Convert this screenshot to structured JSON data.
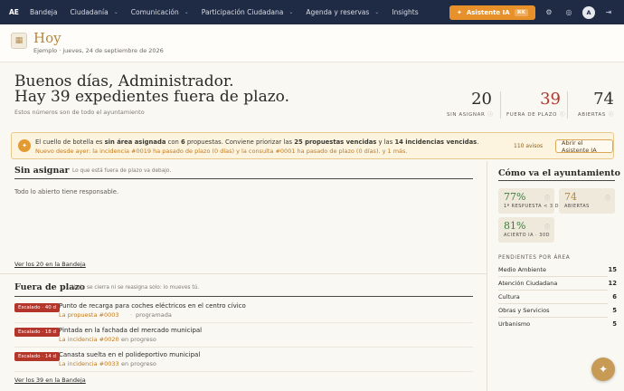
{
  "nav": {
    "logo": "AE",
    "items": [
      {
        "label": "Bandeja",
        "chevron": false
      },
      {
        "label": "Ciudadanía",
        "chevron": true
      },
      {
        "label": "Comunicación",
        "chevron": true
      },
      {
        "label": "Participación Ciudadana",
        "chevron": true
      },
      {
        "label": "Agenda y reservas",
        "chevron": true
      },
      {
        "label": "Insights",
        "chevron": false
      }
    ],
    "ia_button": "Asistente IA",
    "ia_shortcut": "⌘K",
    "avatar": "A"
  },
  "header": {
    "title": "Hoy",
    "subtitle": "Ejemplo · jueves, 24 de septiembre de 2026"
  },
  "greeting": {
    "line1": "Buenos días, Administrador.",
    "line2": "Hay 39 expedientes fuera de plazo.",
    "note": "Estos números son de todo el ayuntamiento"
  },
  "stats": [
    {
      "value": "20",
      "label": "SIN ASIGNAR",
      "color": "#2b2a27"
    },
    {
      "value": "39",
      "label": "FUERA DE PLAZO",
      "color": "#b4362b"
    },
    {
      "value": "74",
      "label": "ABIERTAS",
      "color": "#2b2a27"
    }
  ],
  "alert": {
    "p1": "El cuello de botella es ",
    "b1": "sin área asignada",
    "p2": " con ",
    "b2": "6",
    "p3": " propuestas. Conviene priorizar las ",
    "b3": "25 propuestas vencidas",
    "p4": " y las ",
    "b4": "14 incidencias vencidas",
    "p5": ".",
    "line2": "Nuevo desde ayer: la incidencia #0019 ha pasado de plazo (0 días) y la consulta #0001 ha pasado de plazo (0 días). y 1 más.",
    "count": "110 avisos",
    "button": "Abrir el Asistente IA"
  },
  "unassigned": {
    "title": "Sin asignar",
    "subtitle": "Lo que está fuera de plazo va debajo.",
    "empty": "Todo lo abierto tiene responsable.",
    "link": "Ver los 20 en la Bandeja"
  },
  "overdue": {
    "title": "Fuera de plazo",
    "subtitle": "Nada se cierra ni se reasigna solo: lo mueves tú.",
    "items": [
      {
        "badge": "Escalado · 40 d",
        "title": "Punto de recarga para coches eléctricos en el centro cívico",
        "ref": "La propuesta #0003",
        "state": "programada"
      },
      {
        "badge": "Escalado · 18 d",
        "title": "Pintada en la fachada del mercado municipal",
        "ref": "La incidencia #0020",
        "state": "en progreso"
      },
      {
        "badge": "Escalado · 14 d",
        "title": "Canasta suelta en el polideportivo municipal",
        "ref": "La incidencia #0033",
        "state": "en progreso"
      }
    ],
    "link": "Ver los 39 en la Bandeja"
  },
  "city": {
    "title": "Cómo va el ayuntamiento",
    "kpis": [
      {
        "value": "77%",
        "label": "1ª RESPUESTA < 3 D",
        "color": "#3f7a3f"
      },
      {
        "value": "74",
        "label": "ABIERTAS",
        "color": "#b8863b"
      },
      {
        "value": "81%",
        "label": "ACIERTO IA · 30D",
        "color": "#3f7a3f"
      }
    ],
    "pending_title": "PENDIENTES POR ÁREA",
    "areas": [
      {
        "name": "Medio Ambiente",
        "count": "15"
      },
      {
        "name": "Atención Ciudadana",
        "count": "12"
      },
      {
        "name": "Cultura",
        "count": "6"
      },
      {
        "name": "Obras y Servicios",
        "count": "5"
      },
      {
        "name": "Urbanismo",
        "count": "5"
      }
    ]
  }
}
